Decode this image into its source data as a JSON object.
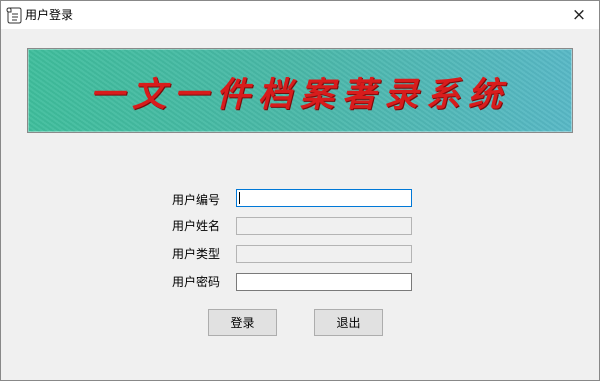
{
  "window": {
    "title": "用户登录",
    "close_glyph": "×"
  },
  "banner": {
    "text": "一文一件档案著录系统"
  },
  "form": {
    "user_id": {
      "label": "用户编号",
      "value": ""
    },
    "user_name": {
      "label": "用户姓名",
      "value": ""
    },
    "user_type": {
      "label": "用户类型",
      "value": ""
    },
    "password": {
      "label": "用户密码",
      "value": ""
    }
  },
  "buttons": {
    "login": "登录",
    "exit": "退出"
  },
  "icons": {
    "app": "scroll-icon",
    "close": "close-icon"
  },
  "colors": {
    "banner_text": "#d81c1c",
    "banner_bg": "#4ab8a8",
    "focus_border": "#0078d7"
  }
}
